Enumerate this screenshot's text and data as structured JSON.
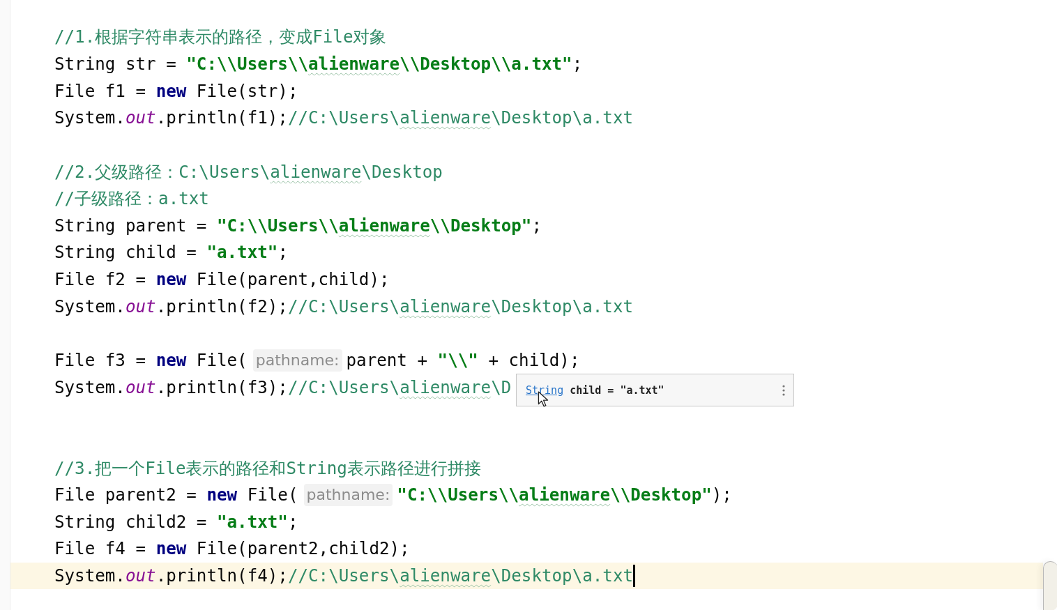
{
  "editor": {
    "lines": [
      {
        "current": false,
        "tokens": [
          {
            "kind": "comment",
            "text": "//1.根据字符串表示的路径，变成File对象"
          }
        ]
      },
      {
        "current": false,
        "tokens": [
          {
            "kind": "plain",
            "text": "String str = "
          },
          {
            "kind": "string",
            "text": "\"C:\\\\Users\\\\"
          },
          {
            "kind": "string_typo",
            "text": "alienware"
          },
          {
            "kind": "string",
            "text": "\\\\Desktop\\\\a.txt\""
          },
          {
            "kind": "plain",
            "text": ";"
          }
        ]
      },
      {
        "current": false,
        "tokens": [
          {
            "kind": "plain",
            "text": "File f1 = "
          },
          {
            "kind": "keyword",
            "text": "new"
          },
          {
            "kind": "plain",
            "text": " File(str);"
          }
        ]
      },
      {
        "current": false,
        "tokens": [
          {
            "kind": "plain",
            "text": "System."
          },
          {
            "kind": "field",
            "text": "out"
          },
          {
            "kind": "plain",
            "text": ".println(f1);"
          },
          {
            "kind": "comment",
            "text": "//C:\\Users\\"
          },
          {
            "kind": "comment_typo",
            "text": "alienware"
          },
          {
            "kind": "comment",
            "text": "\\Desktop\\a.txt"
          }
        ]
      },
      {
        "current": false
      },
      {
        "current": false,
        "tokens": [
          {
            "kind": "comment",
            "text": "//2.父级路径：C:\\Users\\"
          },
          {
            "kind": "comment_typo",
            "text": "alienware"
          },
          {
            "kind": "comment",
            "text": "\\Desktop"
          }
        ]
      },
      {
        "current": false,
        "tokens": [
          {
            "kind": "comment",
            "text": "//子级路径：a.txt"
          }
        ]
      },
      {
        "current": false,
        "tokens": [
          {
            "kind": "plain",
            "text": "String parent = "
          },
          {
            "kind": "string",
            "text": "\"C:\\\\Users\\\\"
          },
          {
            "kind": "string_typo",
            "text": "alienware"
          },
          {
            "kind": "string",
            "text": "\\\\Desktop\""
          },
          {
            "kind": "plain",
            "text": ";"
          }
        ]
      },
      {
        "current": false,
        "tokens": [
          {
            "kind": "plain",
            "text": "String child = "
          },
          {
            "kind": "string",
            "text": "\"a.txt\""
          },
          {
            "kind": "plain",
            "text": ";"
          }
        ]
      },
      {
        "current": false,
        "tokens": [
          {
            "kind": "plain",
            "text": "File f2 = "
          },
          {
            "kind": "keyword",
            "text": "new"
          },
          {
            "kind": "plain",
            "text": " File(parent,child);"
          }
        ]
      },
      {
        "current": false,
        "tokens": [
          {
            "kind": "plain",
            "text": "System."
          },
          {
            "kind": "field",
            "text": "out"
          },
          {
            "kind": "plain",
            "text": ".println(f2);"
          },
          {
            "kind": "comment",
            "text": "//C:\\Users\\"
          },
          {
            "kind": "comment_typo",
            "text": "alienware"
          },
          {
            "kind": "comment",
            "text": "\\Desktop\\a.txt"
          }
        ]
      },
      {
        "current": false
      },
      {
        "current": false,
        "tokens": [
          {
            "kind": "plain",
            "text": "File f3 = "
          },
          {
            "kind": "keyword",
            "text": "new"
          },
          {
            "kind": "plain",
            "text": " File("
          },
          {
            "kind": "hint",
            "text": "pathname:"
          },
          {
            "kind": "plain",
            "text": "parent + "
          },
          {
            "kind": "string",
            "text": "\"\\\\\""
          },
          {
            "kind": "plain",
            "text": " + child);"
          }
        ]
      },
      {
        "current": false,
        "tokens": [
          {
            "kind": "plain",
            "text": "System."
          },
          {
            "kind": "field",
            "text": "out"
          },
          {
            "kind": "plain",
            "text": ".println(f3);"
          },
          {
            "kind": "comment",
            "text": "//C:\\Users\\"
          },
          {
            "kind": "comment_typo",
            "text": "alienware"
          },
          {
            "kind": "comment",
            "text": "\\D"
          }
        ]
      },
      {
        "current": false
      },
      {
        "current": false
      },
      {
        "current": false,
        "tokens": [
          {
            "kind": "comment",
            "text": "//3.把一个File表示的路径和String表示路径进行拼接"
          }
        ]
      },
      {
        "current": false,
        "tokens": [
          {
            "kind": "plain",
            "text": "File parent2 = "
          },
          {
            "kind": "keyword",
            "text": "new"
          },
          {
            "kind": "plain",
            "text": " File("
          },
          {
            "kind": "hint",
            "text": "pathname:"
          },
          {
            "kind": "string",
            "text": "\"C:\\\\Users\\\\"
          },
          {
            "kind": "string_typo",
            "text": "alienware"
          },
          {
            "kind": "string",
            "text": "\\\\Desktop\""
          },
          {
            "kind": "plain",
            "text": ");"
          }
        ]
      },
      {
        "current": false,
        "tokens": [
          {
            "kind": "plain",
            "text": "String child2 = "
          },
          {
            "kind": "string",
            "text": "\"a.txt\""
          },
          {
            "kind": "plain",
            "text": ";"
          }
        ]
      },
      {
        "current": false,
        "tokens": [
          {
            "kind": "plain",
            "text": "File f4 = "
          },
          {
            "kind": "keyword",
            "text": "new"
          },
          {
            "kind": "plain",
            "text": " File(parent2,child2);"
          }
        ]
      },
      {
        "current": true,
        "tokens": [
          {
            "kind": "plain",
            "text": "System."
          },
          {
            "kind": "field",
            "text": "out"
          },
          {
            "kind": "plain",
            "text": ".println(f4);"
          },
          {
            "kind": "comment",
            "text": "//C:\\Users\\"
          },
          {
            "kind": "comment_typo",
            "text": "alienware"
          },
          {
            "kind": "comment",
            "text": "\\Desktop\\a.txt"
          }
        ]
      }
    ]
  },
  "popup": {
    "link": "String",
    "text": "child = \"a.txt\""
  }
}
